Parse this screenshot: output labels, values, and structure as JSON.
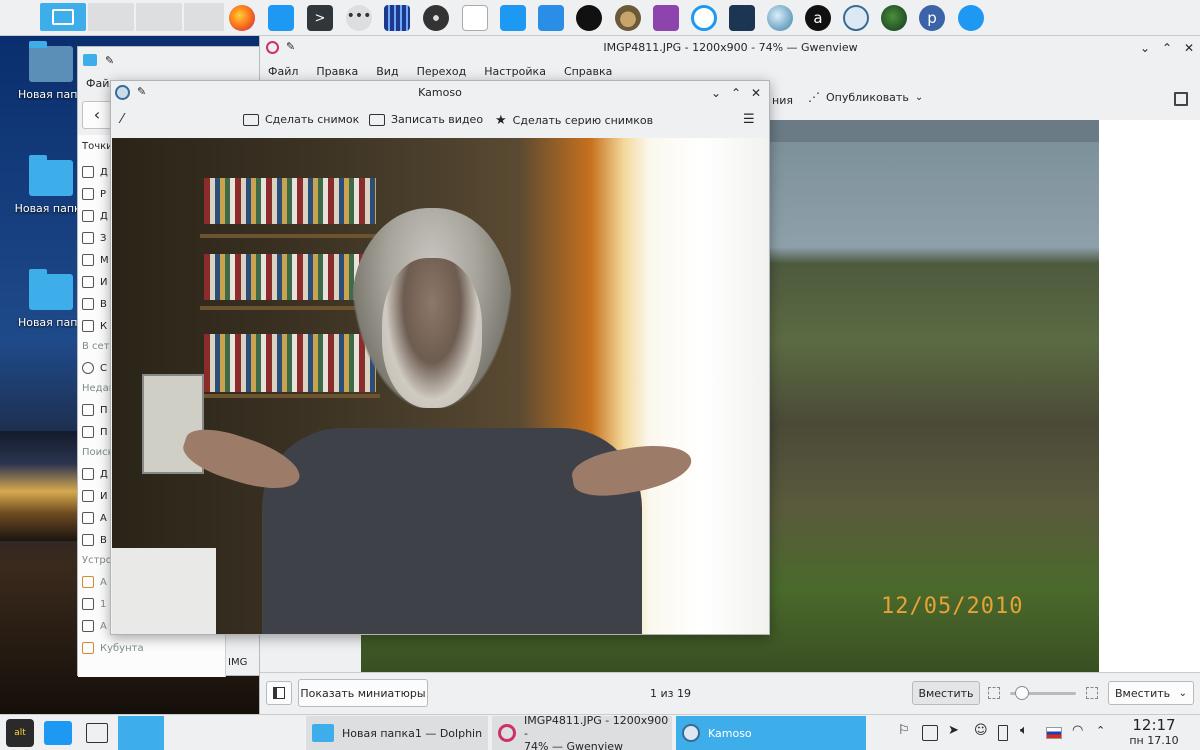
{
  "desktop": {
    "icons": [
      {
        "label": "Новая папк"
      },
      {
        "label": "Новая папка"
      },
      {
        "label": "Новая папк"
      }
    ]
  },
  "dolphin": {
    "menu_fragment": "Файл",
    "sidebar": {
      "heading_places": "Точки",
      "places": [
        "Д",
        "Р",
        "Д",
        "З",
        "М",
        "И",
        "В",
        "К"
      ],
      "heading_network": "В сет",
      "network": [
        "С"
      ],
      "heading_recent": "Недав",
      "recent": [
        "П",
        "П"
      ],
      "heading_search": "Поиск",
      "search": [
        "Д",
        "И",
        "А",
        "В"
      ],
      "heading_devices": "Устро",
      "devices": [
        "А",
        "1",
        "А",
        "Кубунта"
      ]
    },
    "file_fragment": "IMG"
  },
  "gwenview": {
    "title": "IMGP4811.JPG - 1200x900 - 74% — Gwenview",
    "menu": [
      "Файл",
      "Правка",
      "Вид",
      "Переход",
      "Настройка",
      "Справка"
    ],
    "toolbar_fragment": "ния",
    "share_label": "Опубликовать",
    "photo_date": "12/05/2010",
    "show_thumbnails": "Показать миниатюры",
    "counter": "1 из 19",
    "fit_button": "Вместить",
    "fit_select": "Вместить",
    "zoom_level": 0.1
  },
  "kamoso": {
    "title": "Kamoso",
    "take_photo": "Сделать снимок",
    "record_video": "Записать видео",
    "burst": "Сделать серию снимков"
  },
  "taskbar": {
    "tasks": [
      {
        "label": "Новая папка1 — Dolphin"
      },
      {
        "label_line1": "IMGP4811.JPG - 1200x900 -",
        "label_line2": "74% — Gwenview"
      },
      {
        "label": "Kamoso"
      }
    ],
    "clock_time": "12:17",
    "clock_date": "пн 17.10"
  },
  "colors": {
    "accent": "#3daee9",
    "panel": "#eff0f1",
    "date_stamp": "#e6a236"
  }
}
